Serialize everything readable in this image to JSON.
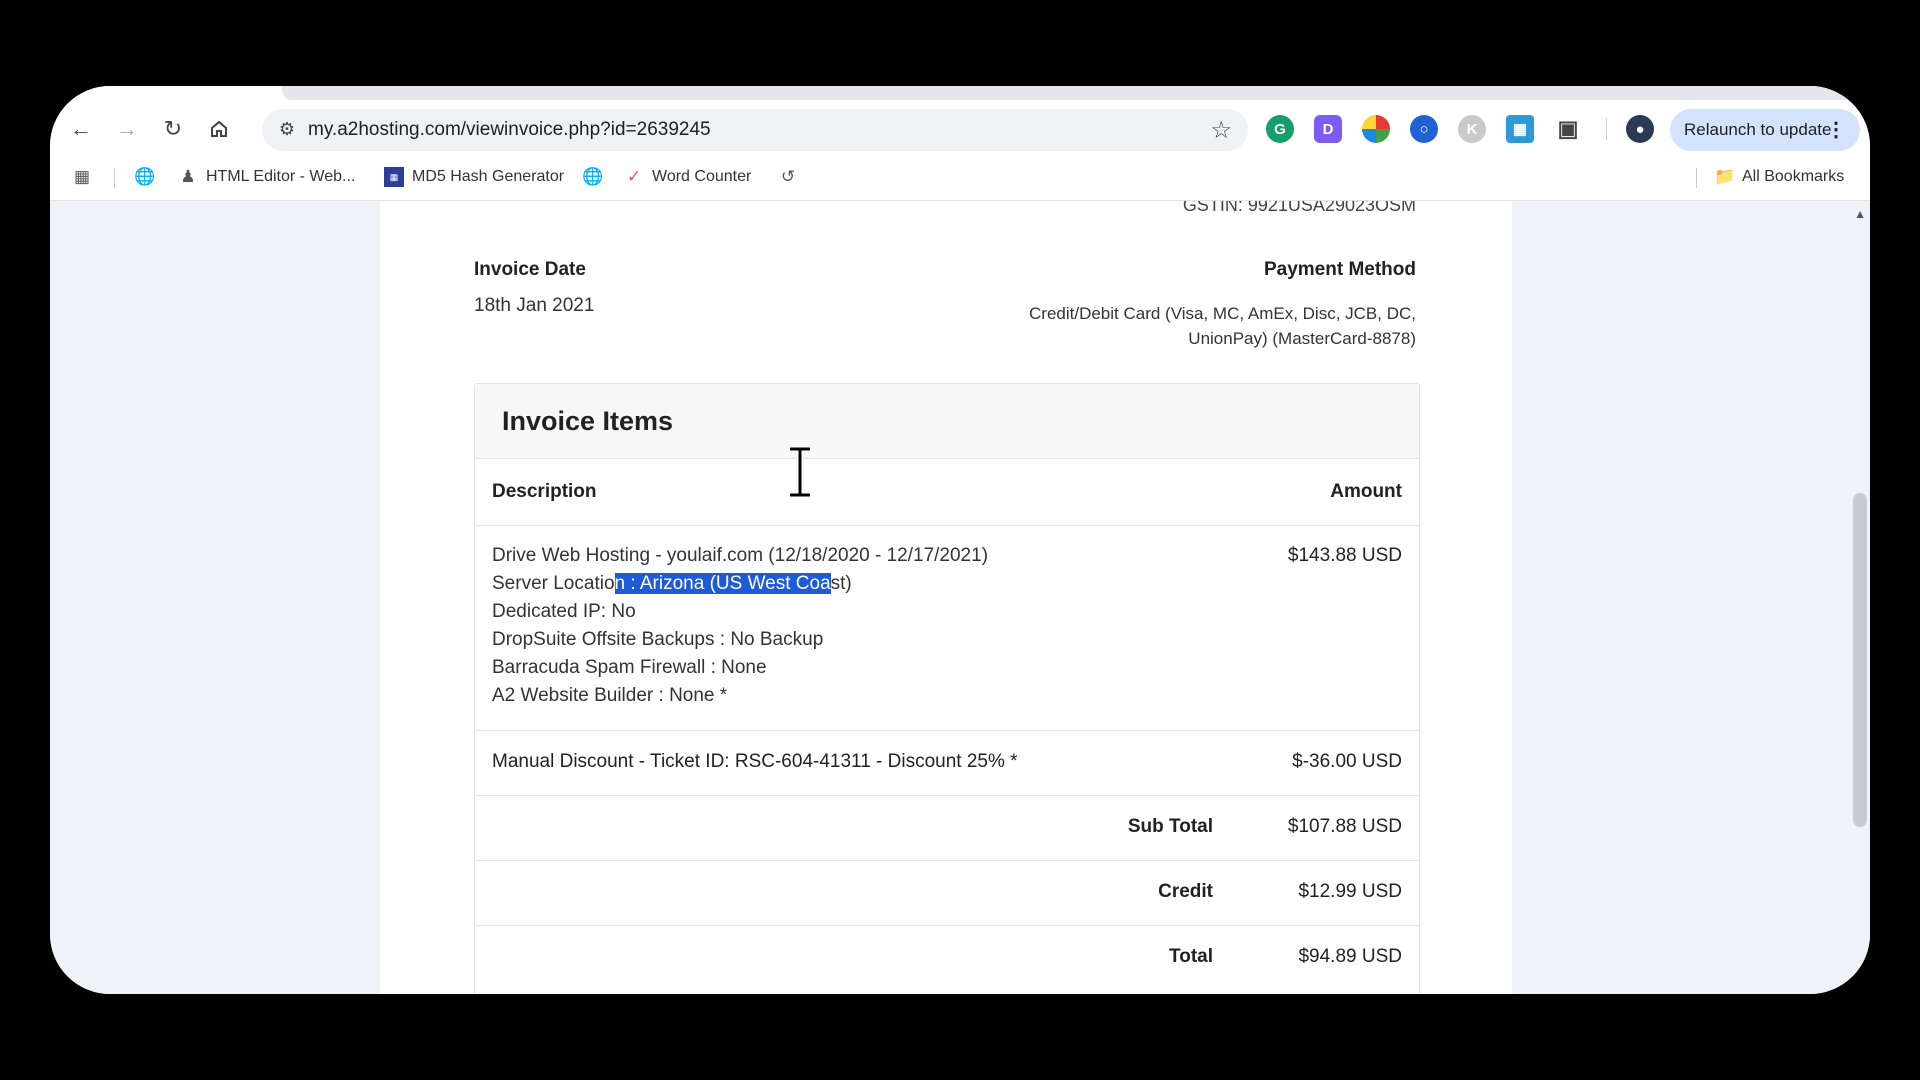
{
  "browser": {
    "url": "my.a2hosting.com/viewinvoice.php?id=2639245",
    "relaunch_label": "Relaunch to update",
    "extensions": [
      "grammarly-icon",
      "d-extension-icon",
      "color-extension-icon",
      "blue-circle-extension-icon",
      "k-extension-icon",
      "map-extension-icon",
      "puzzle-icon"
    ]
  },
  "bookmarks": {
    "items": [
      {
        "label": "HTML Editor - Web..."
      },
      {
        "label": "MD5 Hash Generator"
      },
      {
        "label": "Word Counter"
      }
    ],
    "all_bookmarks": "All Bookmarks"
  },
  "invoice": {
    "gstin": "GSTIN: 9921USA29023OSM",
    "invoice_date_label": "Invoice Date",
    "invoice_date": "18th Jan 2021",
    "payment_method_label": "Payment Method",
    "payment_method_line1": "Credit/Debit Card (Visa, MC, AmEx, Disc, JCB, DC,",
    "payment_method_line2": "UnionPay) (MasterCard-8878)",
    "items_title": "Invoice Items",
    "col_description": "Description",
    "col_amount": "Amount",
    "item1": {
      "line1": "Drive Web Hosting - youlaif.com (12/18/2020 - 12/17/2021)",
      "line2_pre": "Server Locatio",
      "line2_sel": "n : Arizona (US West Coa",
      "line2_post": "st)",
      "line3": "Dedicated IP: No",
      "line4": "DropSuite Offsite Backups : No Backup",
      "line5": "Barracuda Spam Firewall : None",
      "line6": "A2 Website Builder : None *",
      "amount": "$143.88 USD"
    },
    "item2": {
      "desc": "Manual Discount - Ticket ID: RSC-604-41311 - Discount 25% *",
      "amount": "$-36.00 USD"
    },
    "subtotal_label": "Sub Total",
    "subtotal": "$107.88 USD",
    "credit_label": "Credit",
    "credit": "$12.99 USD",
    "total_label": "Total",
    "total": "$94.89 USD"
  }
}
